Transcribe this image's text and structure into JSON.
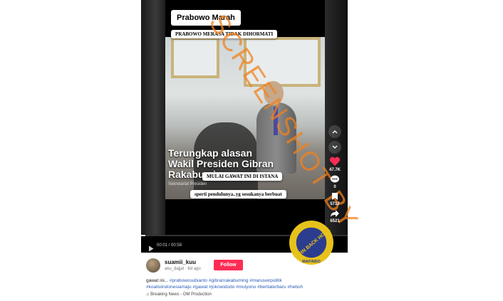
{
  "video": {
    "title_label": "Prabowo Marah",
    "subtitle_label": "PRABOWO MERASA TIDAK DIHORMATI",
    "caption_big": "Terungkap alasan Wakil Presiden Gibran Rakabuming",
    "source_label": "Sekretariat Presiden",
    "overlay_line1": "MULAI GAWAT INI DI ISTANA",
    "overlay_line2": "sperti pendulunya..yg sesukanya berbuat",
    "watermark": "SCREENSHOT BY",
    "time": "00:01 / 00:58",
    "progress": 0.02
  },
  "actions": {
    "likes": "47.7K",
    "comments": "0",
    "bookmarks": "5712",
    "shares": "6521"
  },
  "author": {
    "username": "suamii_kuu",
    "handle_date": "aku_dajjal · 6d ago",
    "follow_label": "Follow"
  },
  "description": {
    "text": "gawat ini...",
    "tags_line1": "#prabowosubianto #gibranrakabuming #manuverpolitik",
    "tags_line2": "#koalisiindonesiamaju #gawat #jokowidodo #mulyono #beritaterbaru #heboh",
    "music": "♫ Breaking News - OM Production"
  },
  "badge": {
    "ring_text": "MASYARAKAT ANTI FITNAH INDONESIA",
    "center_text": "TURN BACK HOAX",
    "bottom_text": "MAFINDO"
  },
  "colors": {
    "follow": "#fe2c55",
    "like": "#fe2c55",
    "watermark": "#f0821e",
    "hashtag": "#2b5db6"
  }
}
